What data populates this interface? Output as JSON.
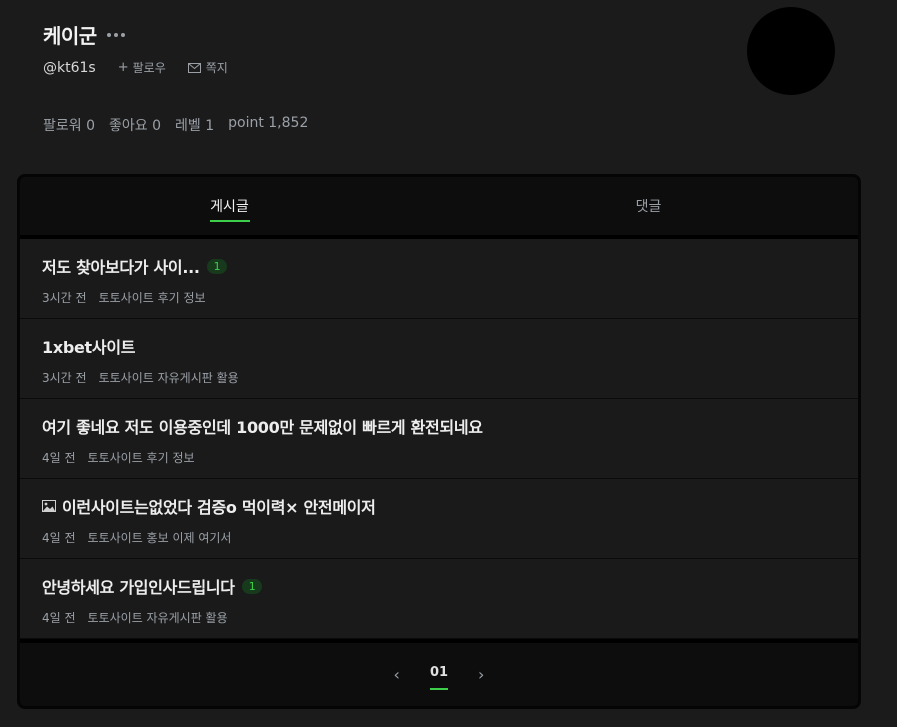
{
  "profile": {
    "name": "케이군",
    "handle": "@kt61s",
    "follow_label": "팔로우",
    "message_label": "쪽지",
    "stats": [
      "팔로워 0",
      "좋아요 0",
      "레벨 1",
      "point 1,852"
    ]
  },
  "tabs": [
    {
      "label": "게시글",
      "active": true
    },
    {
      "label": "댓글",
      "active": false
    }
  ],
  "posts": [
    {
      "title": "저도 찾아보다가  사이...",
      "badge": "1",
      "time": "3시간 전",
      "board": "토토사이트 후기 정보"
    },
    {
      "title": "1xbet사이트",
      "time": "3시간 전",
      "board": "토토사이트 자유게시판 활용"
    },
    {
      "title": "여기 좋네요 저도 이용중인데 1000만 문제없이 빠르게 환전되네요",
      "time": "4일 전",
      "board": "토토사이트 후기 정보"
    },
    {
      "title": "이런사이트는없었다 검증o 먹이력× 안전메이저",
      "icon": "image-icon",
      "time": "4일 전",
      "board": "토토사이트 홍보 이제 여기서"
    },
    {
      "title": "안녕하세요 가입인사드립니다",
      "badge": "1",
      "time": "4일 전",
      "board": "토토사이트 자유게시판 활용"
    }
  ],
  "pagination": {
    "prev": "‹",
    "current": "01",
    "next": "›"
  },
  "colors": {
    "accent": "#3ecf4a",
    "background": "#1b1b1c"
  }
}
